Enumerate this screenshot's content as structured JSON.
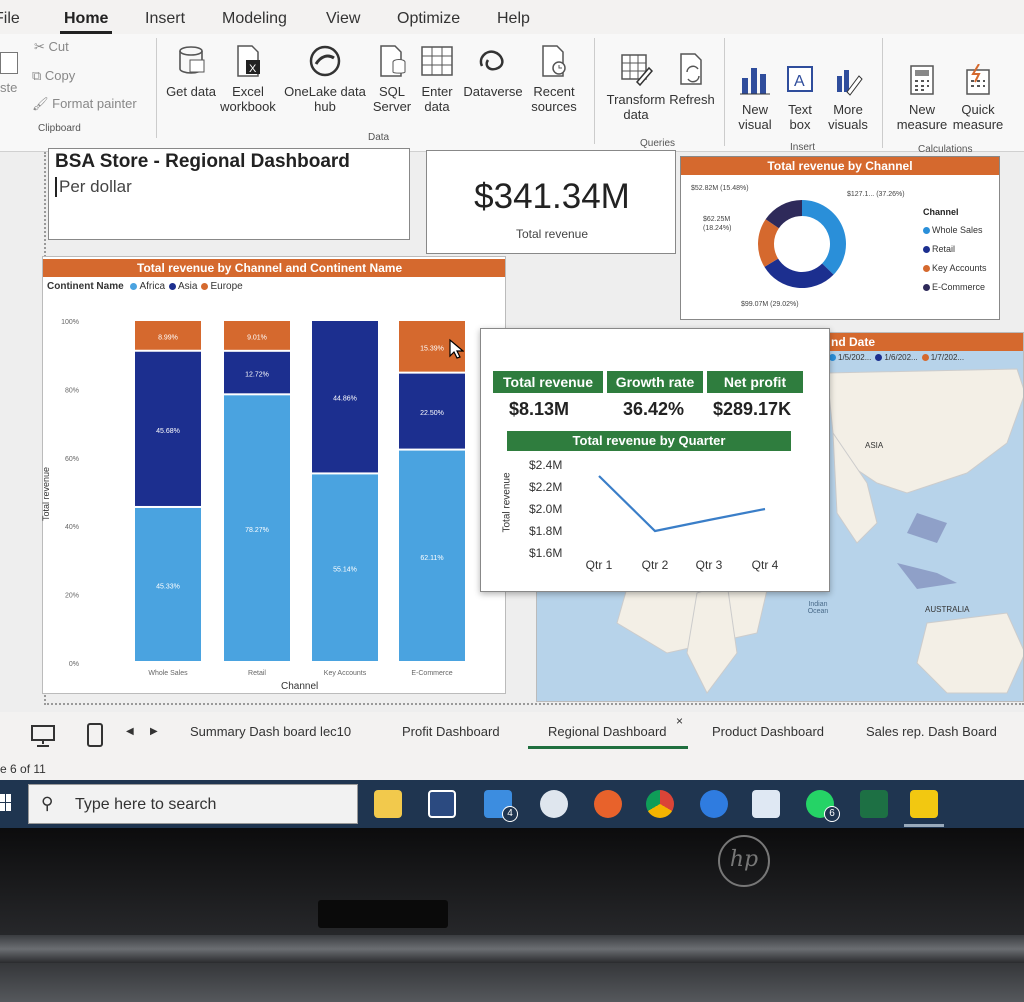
{
  "ribbon_tabs": [
    {
      "label": "File",
      "x": 0
    },
    {
      "label": "Home",
      "active": true
    },
    {
      "label": "Insert"
    },
    {
      "label": "Modeling"
    },
    {
      "label": "View"
    },
    {
      "label": "Optimize"
    },
    {
      "label": "Help"
    }
  ],
  "clipboard": {
    "paste": "ste",
    "cut": "Cut",
    "copy": "Copy",
    "format_painter": "Format painter",
    "group": "Clipboard"
  },
  "data_group": {
    "get_data": "Get data",
    "excel": "Excel workbook",
    "onelake": "OneLake data hub",
    "sql": "SQL Server",
    "enter_data": "Enter data",
    "dataverse": "Dataverse",
    "recent": "Recent sources",
    "group": "Data"
  },
  "queries_group": {
    "transform": "Transform data",
    "refresh": "Refresh",
    "group": "Queries"
  },
  "insert_group": {
    "new_visual": "New visual",
    "text_box": "Text box",
    "more_visuals": "More visuals",
    "group": "Insert"
  },
  "calc_group": {
    "new_measure": "New measure",
    "quick_measure": "Quick measure",
    "group": "Calculations"
  },
  "report": {
    "title": "BSA Store - Regional Dashboard",
    "subtitle": "Per dollar",
    "kpi_value": "$341.34M",
    "kpi_label": "Total revenue"
  },
  "donut": {
    "title": "Total revenue by Channel",
    "legend_title": "Channel",
    "legend": [
      {
        "label": "Whole Sales",
        "color": "#2a8fd9"
      },
      {
        "label": "Retail",
        "color": "#1c2f8f"
      },
      {
        "label": "Key Accounts",
        "color": "#d5692e"
      },
      {
        "label": "E-Commerce",
        "color": "#2e2a5a"
      }
    ],
    "labels": {
      "top_left": "$52.82M (15.48%)",
      "top_right": "$127.1... (37.26%)",
      "left": "$62.25M (18.24%)",
      "bottom": "$99.07M (29.02%)"
    },
    "values": [
      37.26,
      29.02,
      18.24,
      15.48
    ]
  },
  "bar": {
    "title": "Total revenue by Channel and Continent Name",
    "legend_title": "Continent Name",
    "legend": [
      {
        "label": "Africa",
        "color": "#4aa3e0"
      },
      {
        "label": "Asia",
        "color": "#1c2f8f"
      },
      {
        "label": "Europe",
        "color": "#d5692e"
      }
    ],
    "ylabel": "Total revenue",
    "xlabel": "Channel",
    "yticks": [
      "100%",
      "80%",
      "60%",
      "40%",
      "20%",
      "0%"
    ]
  },
  "chart_data": [
    {
      "type": "bar",
      "title": "Total revenue by Channel and Continent Name",
      "stacked": "100%",
      "categories": [
        "Whole Sales",
        "Retail",
        "Key Accounts",
        "E-Commerce"
      ],
      "series": [
        {
          "name": "Africa",
          "values": [
            45.33,
            78.27,
            55.14,
            62.11
          ],
          "labels": [
            "45.33%",
            "78.27%",
            "55.14%",
            "62.11%"
          ]
        },
        {
          "name": "Asia",
          "values": [
            45.68,
            12.72,
            44.86,
            22.5
          ],
          "labels": [
            "45.68%",
            "12.72%",
            "44.86%",
            "22.50%"
          ]
        },
        {
          "name": "Europe",
          "values": [
            8.99,
            9.01,
            0,
            15.39
          ],
          "labels": [
            "8.99%",
            "9.01%",
            "",
            "15.39%"
          ]
        }
      ],
      "xlabel": "Channel",
      "ylabel": "Total revenue",
      "ylim": [
        0,
        100
      ]
    },
    {
      "type": "line",
      "title": "Total revenue by Quarter",
      "x": [
        "Qtr 1",
        "Qtr 2",
        "Qtr 3",
        "Qtr 4"
      ],
      "values": [
        2.3,
        1.8,
        1.9,
        2.0
      ],
      "yticks": [
        "$2.4M",
        "$2.2M",
        "$2.0M",
        "$1.8M",
        "$1.6M"
      ],
      "ylim": [
        1.6,
        2.4
      ],
      "ylabel": "Total revenue"
    }
  ],
  "tooltip": {
    "kpi1_label": "Total revenue",
    "kpi1_value": "$8.13M",
    "kpi2_label": "Growth rate",
    "kpi2_value": "36.42%",
    "kpi3_label": "Net profit",
    "kpi3_value": "$289.17K",
    "line_title": "Total revenue by Quarter",
    "ylabel": "Total revenue"
  },
  "map": {
    "title": "nd Date",
    "legend": [
      "1/5/202...",
      "1/6/202...",
      "1/7/202..."
    ],
    "asia": "ASIA",
    "australia": "AUSTRALIA",
    "ocean": "Indian Ocean"
  },
  "page_tabs": [
    "Summary Dash board lec10",
    "Profit Dashboard",
    "Regional Dashboard",
    "Product Dashboard",
    "Sales rep. Dash Board"
  ],
  "page_status": "e 6 of 11",
  "taskbar": {
    "search_placeholder": "Type here to search",
    "mail_badge": "4",
    "whatsapp_badge": "6"
  },
  "brand": {
    "logo": "hp"
  }
}
